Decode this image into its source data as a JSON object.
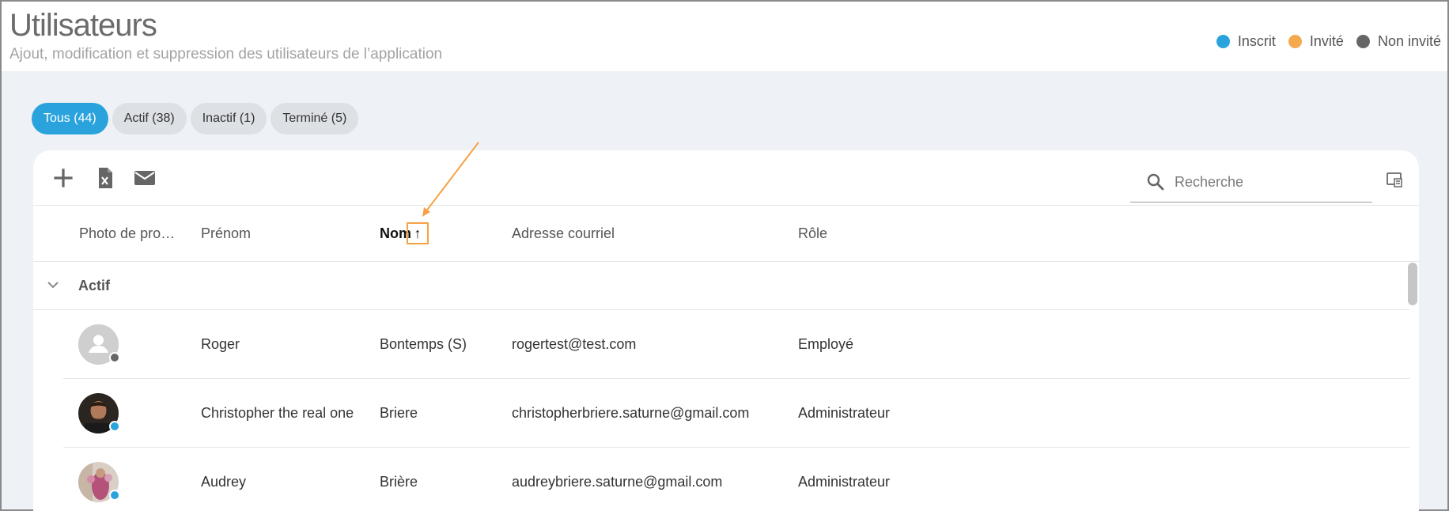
{
  "header": {
    "title": "Utilisateurs",
    "subtitle": "Ajout, modification et suppression des utilisateurs de l’application"
  },
  "legend": [
    {
      "label": "Inscrit",
      "color": "#2aa3dd"
    },
    {
      "label": "Invité",
      "color": "#f5a94f"
    },
    {
      "label": "Non invité",
      "color": "#666666"
    }
  ],
  "tabs": [
    {
      "label": "Tous (44)",
      "active": true
    },
    {
      "label": "Actif (38)",
      "active": false
    },
    {
      "label": "Inactif (1)",
      "active": false
    },
    {
      "label": "Terminé (5)",
      "active": false
    }
  ],
  "toolbar": {
    "icons": [
      "add-icon",
      "excel-export-icon",
      "mail-icon"
    ],
    "search_placeholder": "Recherche"
  },
  "table": {
    "columns": [
      "Photo de pro…",
      "Prénom",
      "Nom",
      "Adresse courriel",
      "Rôle"
    ],
    "sort_indicator": "↑",
    "group_label": "Actif",
    "rows": [
      {
        "prenom": "Roger",
        "nom": "Bontemps (S)",
        "email": "rogertest@test.com",
        "role": "Employé",
        "status_color": "#666666",
        "avatar": "placeholder"
      },
      {
        "prenom": "Christopher the real one",
        "nom": "Briere",
        "email": "christopherbriere.saturne@gmail.com",
        "role": "Administrateur",
        "status_color": "#2aa3dd",
        "avatar": "photo-dark"
      },
      {
        "prenom": "Audrey",
        "nom": "Brière",
        "email": "audreybriere.saturne@gmail.com",
        "role": "Administrateur",
        "status_color": "#2aa3dd",
        "avatar": "photo-pink"
      }
    ]
  },
  "colors": {
    "accent": "#2aa3dd",
    "annotation": "#f7a146"
  }
}
